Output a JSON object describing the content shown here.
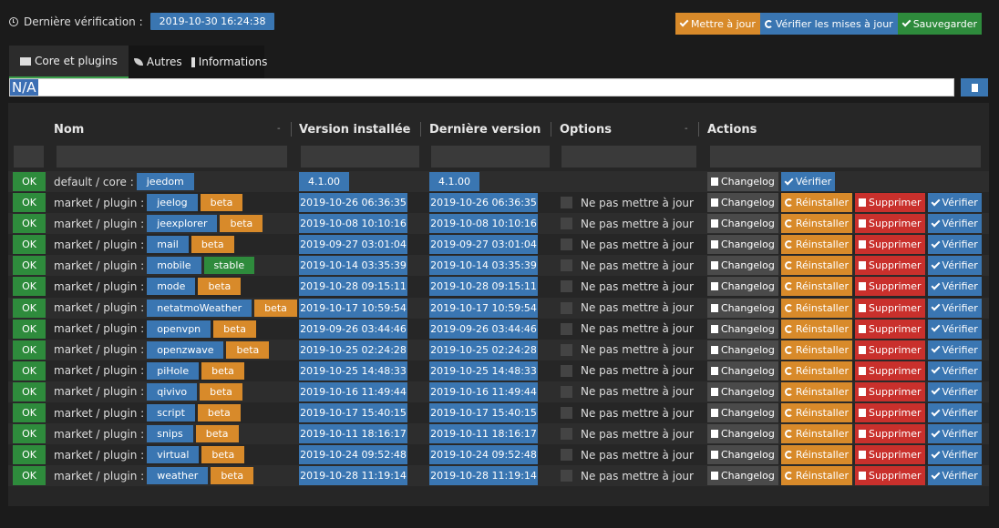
{
  "header": {
    "last_check_label": "Dernière vérification :",
    "last_check_date": "2019-10-30 16:24:38",
    "update_label": "Mettre à jour",
    "check_updates_label": "Vérifier les mises à jour",
    "save_label": "Sauvegarder"
  },
  "tabs": [
    {
      "label": "Core et plugins"
    },
    {
      "label": "Autres"
    },
    {
      "label": "Informations"
    }
  ],
  "search": {
    "value": "N/A"
  },
  "table": {
    "columns": {
      "nom": "Nom",
      "version_installee": "Version installée",
      "derniere_version": "Dernière version",
      "options": "Options",
      "actions": "Actions"
    },
    "sort_marker": "-",
    "core_row": {
      "status": "OK",
      "prefix": "default / core :",
      "name": "jeedom",
      "installed": "4.1.00",
      "latest": "4.1.00",
      "changelog": "Changelog",
      "verify": "Vérifier"
    },
    "plugin_prefix": "market / plugin :",
    "no_update_label": "Ne pas mettre à jour",
    "btn_changelog": "Changelog",
    "btn_reinstall": "Réinstaller",
    "btn_delete": "Supprimer",
    "btn_verify": "Vérifier",
    "rows": [
      {
        "status": "OK",
        "name": "jeelog",
        "channel": "beta",
        "installed": "2019-10-26 06:36:35",
        "latest": "2019-10-26 06:36:35"
      },
      {
        "status": "OK",
        "name": "jeexplorer",
        "channel": "beta",
        "installed": "2019-10-08 10:10:16",
        "latest": "2019-10-08 10:10:16"
      },
      {
        "status": "OK",
        "name": "mail",
        "channel": "beta",
        "installed": "2019-09-27 03:01:04",
        "latest": "2019-09-27 03:01:04"
      },
      {
        "status": "OK",
        "name": "mobile",
        "channel": "stable",
        "installed": "2019-10-14 03:35:39",
        "latest": "2019-10-14 03:35:39"
      },
      {
        "status": "OK",
        "name": "mode",
        "channel": "beta",
        "installed": "2019-10-28 09:15:11",
        "latest": "2019-10-28 09:15:11"
      },
      {
        "status": "OK",
        "name": "netatmoWeather",
        "channel": "beta",
        "installed": "2019-10-17 10:59:54",
        "latest": "2019-10-17 10:59:54"
      },
      {
        "status": "OK",
        "name": "openvpn",
        "channel": "beta",
        "installed": "2019-09-26 03:44:46",
        "latest": "2019-09-26 03:44:46"
      },
      {
        "status": "OK",
        "name": "openzwave",
        "channel": "beta",
        "installed": "2019-10-25 02:24:28",
        "latest": "2019-10-25 02:24:28"
      },
      {
        "status": "OK",
        "name": "piHole",
        "channel": "beta",
        "installed": "2019-10-25 14:48:33",
        "latest": "2019-10-25 14:48:33"
      },
      {
        "status": "OK",
        "name": "qivivo",
        "channel": "beta",
        "installed": "2019-10-16 11:49:44",
        "latest": "2019-10-16 11:49:44"
      },
      {
        "status": "OK",
        "name": "script",
        "channel": "beta",
        "installed": "2019-10-17 15:40:15",
        "latest": "2019-10-17 15:40:15"
      },
      {
        "status": "OK",
        "name": "snips",
        "channel": "beta",
        "installed": "2019-10-11 18:16:17",
        "latest": "2019-10-11 18:16:17"
      },
      {
        "status": "OK",
        "name": "virtual",
        "channel": "beta",
        "installed": "2019-10-24 09:52:48",
        "latest": "2019-10-24 09:52:48"
      },
      {
        "status": "OK",
        "name": "weather",
        "channel": "beta",
        "installed": "2019-10-28 11:19:14",
        "latest": "2019-10-28 11:19:14"
      }
    ]
  }
}
